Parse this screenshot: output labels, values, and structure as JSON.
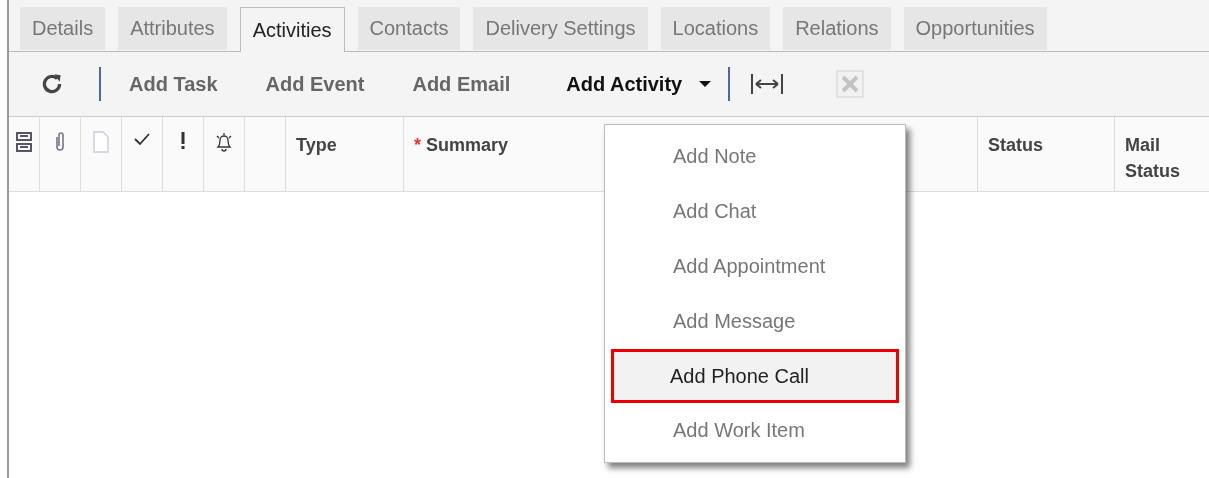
{
  "tabs": [
    {
      "label": "Details",
      "selected": false
    },
    {
      "label": "Attributes",
      "selected": false
    },
    {
      "label": "Activities",
      "selected": true
    },
    {
      "label": "Contacts",
      "selected": false
    },
    {
      "label": "Delivery Settings",
      "selected": false
    },
    {
      "label": "Locations",
      "selected": false
    },
    {
      "label": "Relations",
      "selected": false
    },
    {
      "label": "Opportunities",
      "selected": false
    }
  ],
  "toolbar": {
    "actions": [
      {
        "label": "Add Task"
      },
      {
        "label": "Add Event"
      },
      {
        "label": "Add Email"
      }
    ],
    "dropdown": {
      "label": "Add Activity",
      "expanded": true
    },
    "export_disabled": true
  },
  "table": {
    "columns": [
      {
        "label": "Type",
        "required": false
      },
      {
        "label": "Summary",
        "required": true
      },
      {
        "label": "Status",
        "required": false
      },
      {
        "label": "Mail Status",
        "required": false
      }
    ],
    "required_mark": "*"
  },
  "menu": {
    "items": [
      {
        "label": "Add Note",
        "selected": false
      },
      {
        "label": "Add Chat",
        "selected": false
      },
      {
        "label": "Add Appointment",
        "selected": false
      },
      {
        "label": "Add Message",
        "selected": false
      },
      {
        "label": "Add Phone Call",
        "selected": true
      },
      {
        "label": "Add Work Item",
        "selected": false
      }
    ]
  }
}
